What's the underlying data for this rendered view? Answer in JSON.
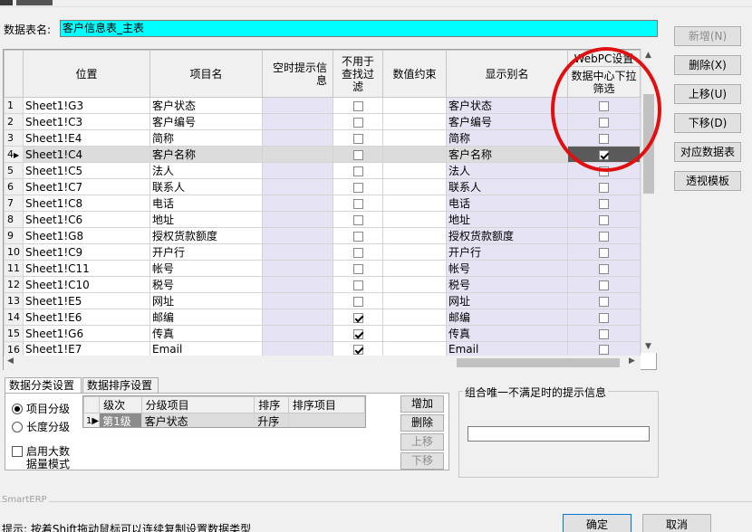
{
  "form": {
    "table_name_label": "数据表名:",
    "table_name_value": "客户信息表_主表"
  },
  "grid": {
    "headers": {
      "position": "位置",
      "item_name": "项目名",
      "empty_hint": "空时提示信息",
      "no_filter": "不用于查找过滤",
      "value_constraint": "数值约束",
      "display_alias": "显示别名",
      "webpc_group": "WebPC设置",
      "webpc_filter": "数据中心下拉筛选"
    },
    "rows": [
      {
        "no": "1",
        "position": "Sheet1!G3",
        "item": "客户状态",
        "no_filter": false,
        "alias": "客户状态",
        "webpc": false
      },
      {
        "no": "2",
        "position": "Sheet1!C3",
        "item": "客户编号",
        "no_filter": false,
        "alias": "客户编号",
        "webpc": false
      },
      {
        "no": "3",
        "position": "Sheet1!E4",
        "item": "简称",
        "no_filter": false,
        "alias": "简称",
        "webpc": false
      },
      {
        "no": "4",
        "position": "Sheet1!C4",
        "item": "客户名称",
        "no_filter": false,
        "alias": "客户名称",
        "webpc": true
      },
      {
        "no": "5",
        "position": "Sheet1!C5",
        "item": "法人",
        "no_filter": false,
        "alias": "法人",
        "webpc": false
      },
      {
        "no": "6",
        "position": "Sheet1!C7",
        "item": "联系人",
        "no_filter": false,
        "alias": "联系人",
        "webpc": false
      },
      {
        "no": "7",
        "position": "Sheet1!C8",
        "item": "电话",
        "no_filter": false,
        "alias": "电话",
        "webpc": false
      },
      {
        "no": "8",
        "position": "Sheet1!C6",
        "item": "地址",
        "no_filter": false,
        "alias": "地址",
        "webpc": false
      },
      {
        "no": "9",
        "position": "Sheet1!G8",
        "item": "授权货款额度",
        "no_filter": false,
        "alias": "授权货款额度",
        "webpc": false
      },
      {
        "no": "10",
        "position": "Sheet1!C9",
        "item": "开户行",
        "no_filter": false,
        "alias": "开户行",
        "webpc": false
      },
      {
        "no": "11",
        "position": "Sheet1!C11",
        "item": "帐号",
        "no_filter": false,
        "alias": "帐号",
        "webpc": false
      },
      {
        "no": "12",
        "position": "Sheet1!C10",
        "item": "税号",
        "no_filter": false,
        "alias": "税号",
        "webpc": false
      },
      {
        "no": "13",
        "position": "Sheet1!E5",
        "item": "网址",
        "no_filter": false,
        "alias": "网址",
        "webpc": false
      },
      {
        "no": "14",
        "position": "Sheet1!E6",
        "item": "邮编",
        "no_filter": true,
        "alias": "邮编",
        "webpc": false
      },
      {
        "no": "15",
        "position": "Sheet1!G6",
        "item": "传真",
        "no_filter": true,
        "alias": "传真",
        "webpc": false
      },
      {
        "no": "16",
        "position": "Sheet1!E7",
        "item": "Email",
        "no_filter": true,
        "alias": "Email",
        "webpc": false
      }
    ]
  },
  "right_buttons": {
    "add": "新增(N)",
    "delete": "删除(X)",
    "move_up": "上移(U)",
    "move_down": "下移(D)",
    "map_table": "对应数据表",
    "pivot_template": "透视模板"
  },
  "tabs": {
    "classify": "数据分类设置",
    "sort": "数据排序设置"
  },
  "classify": {
    "radio_item": "项目分级",
    "radio_length": "长度分级",
    "big_data_line1": "启用大数",
    "big_data_line2": "据量模式",
    "headers": {
      "level": "级次",
      "level_item": "分级项目",
      "sort": "排序",
      "sort_item": "排序项目"
    },
    "row": {
      "no": "1",
      "level": "第1级",
      "item": "客户状态",
      "sort": "升序",
      "sort_item": ""
    },
    "buttons": {
      "add": "增加",
      "delete": "删除",
      "up": "上移",
      "down": "下移"
    }
  },
  "unique": {
    "legend": "组合唯一不满足时的提示信息",
    "value": ""
  },
  "footer": {
    "brand": "SmartERP",
    "hint": "提示: 按着Shift拖动鼠标可以连续复制设置数据类型",
    "ok": "确定",
    "cancel": "取消"
  }
}
